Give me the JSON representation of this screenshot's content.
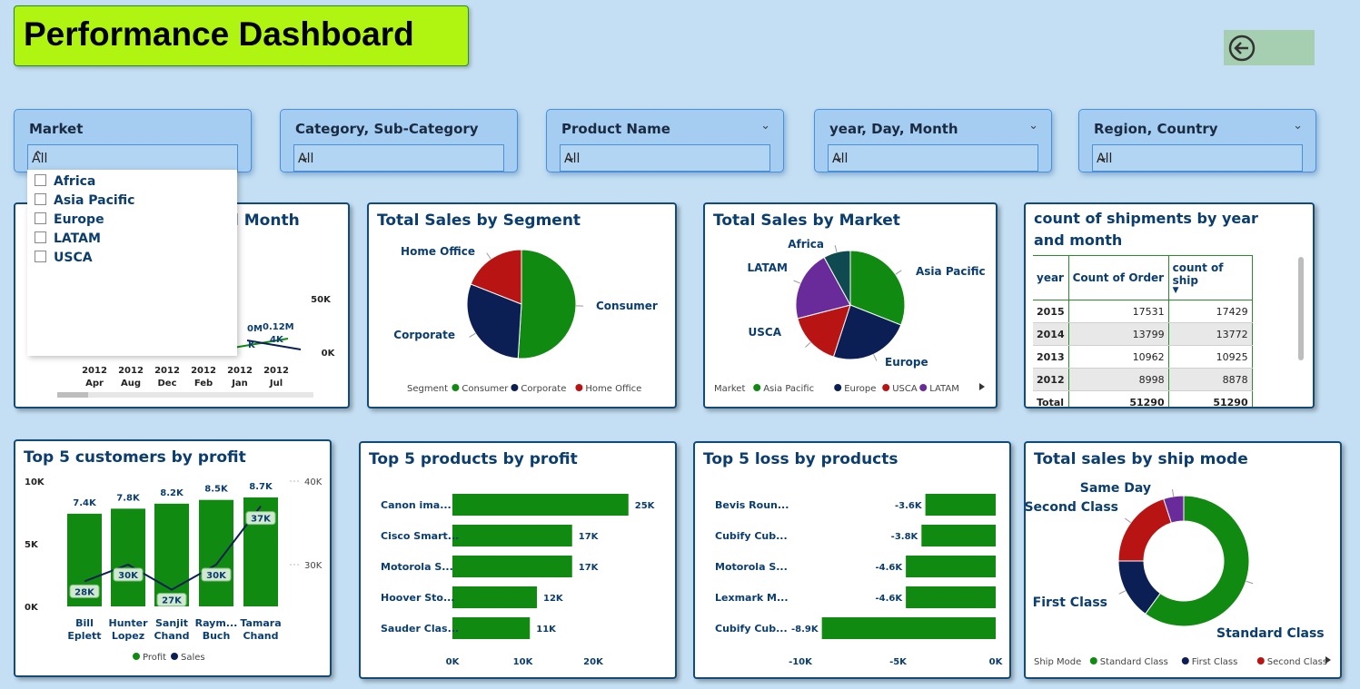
{
  "title": "Performance Dashboard",
  "slicers": [
    {
      "label": "Market",
      "value": "All"
    },
    {
      "label": "Category, Sub-Category",
      "value": "All"
    },
    {
      "label": "Product Name",
      "value": "All"
    },
    {
      "label": "year, Day, Month",
      "value": "All"
    },
    {
      "label": "Region, Country",
      "value": "All"
    }
  ],
  "market_dropdown": {
    "options": [
      "Africa",
      "Asia Pacific",
      "Europe",
      "LATAM",
      "USCA"
    ]
  },
  "cards": {
    "sales_by_month_partial": "l Month",
    "segment": "Total Sales by Segment",
    "market": "Total Sales by Market",
    "shipments": "count of shipments by year and month",
    "customers": "Top 5 customers by profit",
    "products": "Top 5 products by profit",
    "loss": "Top 5 loss by products",
    "shipmode": "Total sales by ship mode"
  },
  "month_chart": {
    "y_ticks": [
      "50K",
      "0K"
    ],
    "labels": [
      "0M",
      "0.12M",
      "4K",
      "K"
    ],
    "x_labels": [
      [
        "2012",
        "Apr"
      ],
      [
        "2012",
        "Aug"
      ],
      [
        "2012",
        "Dec"
      ],
      [
        "2012",
        "Feb"
      ],
      [
        "2012",
        "Jan"
      ],
      [
        "2012",
        "Jul"
      ]
    ]
  },
  "shipments_table": {
    "headers": [
      "year",
      "Count of Order",
      "count of ship"
    ],
    "rows": [
      [
        "2015",
        "17531",
        "17429"
      ],
      [
        "2014",
        "13799",
        "13772"
      ],
      [
        "2013",
        "10962",
        "10925"
      ],
      [
        "2012",
        "8998",
        "8878"
      ]
    ],
    "total": [
      "Total",
      "51290",
      "51290"
    ]
  },
  "chart_data": [
    {
      "type": "pie",
      "title": "Total Sales by Segment",
      "legend_title": "Segment",
      "slices": [
        {
          "name": "Consumer",
          "value": 51,
          "color": "#118a11"
        },
        {
          "name": "Corporate",
          "value": 30,
          "color": "#0c1f54"
        },
        {
          "name": "Home Office",
          "value": 19,
          "color": "#b81414"
        }
      ]
    },
    {
      "type": "pie",
      "title": "Total Sales by Market",
      "legend_title": "Market",
      "slices": [
        {
          "name": "Asia Pacific",
          "value": 31,
          "color": "#118a11"
        },
        {
          "name": "Europe",
          "value": 24,
          "color": "#0c1f54"
        },
        {
          "name": "USCA",
          "value": 16,
          "color": "#b81414"
        },
        {
          "name": "LATAM",
          "value": 21,
          "color": "#6a2b9a"
        },
        {
          "name": "Africa",
          "value": 8,
          "color": "#0e4a50"
        }
      ],
      "legend": [
        "Asia Pacific",
        "Europe",
        "USCA",
        "LATAM"
      ]
    },
    {
      "type": "bar",
      "title": "Top 5 customers by profit",
      "categories": [
        [
          "Bill",
          "Eplett"
        ],
        [
          "Hunter",
          "Lopez"
        ],
        [
          "Sanjit",
          "Chand"
        ],
        [
          "Raym...",
          "Buch"
        ],
        [
          "Tamara",
          "Chand"
        ]
      ],
      "series": [
        {
          "name": "Profit",
          "values": [
            7.4,
            7.8,
            8.2,
            8.5,
            8.7
          ],
          "labels": [
            "7.4K",
            "7.8K",
            "8.2K",
            "8.5K",
            "8.7K"
          ]
        },
        {
          "name": "Sales",
          "values": [
            28,
            30,
            27,
            30,
            37
          ],
          "labels": [
            "28K",
            "30K",
            "27K",
            "30K",
            "37K"
          ]
        }
      ],
      "y_left_ticks": [
        "10K",
        "5K",
        "0K"
      ],
      "y_right_ticks": [
        "40K",
        "30K"
      ],
      "ylim_left": [
        0,
        10
      ],
      "ylim_right": [
        25,
        40
      ]
    },
    {
      "type": "bar",
      "title": "Top 5 products by profit",
      "categories": [
        "Canon ima...",
        "Cisco Smart...",
        "Motorola S...",
        "Hoover Sto...",
        "Sauder Clas..."
      ],
      "values": [
        25,
        17,
        17,
        12,
        11
      ],
      "labels": [
        "25K",
        "17K",
        "17K",
        "12K",
        "11K"
      ],
      "x_ticks": [
        "0K",
        "10K",
        "20K"
      ],
      "xlim": [
        0,
        28
      ]
    },
    {
      "type": "bar",
      "title": "Top 5 loss by products",
      "categories": [
        "Bevis Roun...",
        "Cubify Cub...",
        "Motorola S...",
        "Lexmark M...",
        "Cubify Cub..."
      ],
      "values": [
        -3.6,
        -3.8,
        -4.6,
        -4.6,
        -8.9
      ],
      "labels": [
        "-3.6K",
        "-3.8K",
        "-4.6K",
        "-4.6K",
        "-8.9K"
      ],
      "x_ticks": [
        "-10K",
        "-5K",
        "0K"
      ],
      "xlim": [
        -10,
        0
      ]
    },
    {
      "type": "pie",
      "title": "Total sales by ship mode",
      "legend_title": "Ship Mode",
      "slices": [
        {
          "name": "Standard Class",
          "value": 60,
          "color": "#118a11"
        },
        {
          "name": "First Class",
          "value": 15,
          "color": "#0c1f54"
        },
        {
          "name": "Second Class",
          "value": 20,
          "color": "#b81414"
        },
        {
          "name": "Same Day",
          "value": 5,
          "color": "#6a2b9a"
        }
      ],
      "legend": [
        "Standard Class",
        "First Class",
        "Second Class"
      ]
    }
  ]
}
